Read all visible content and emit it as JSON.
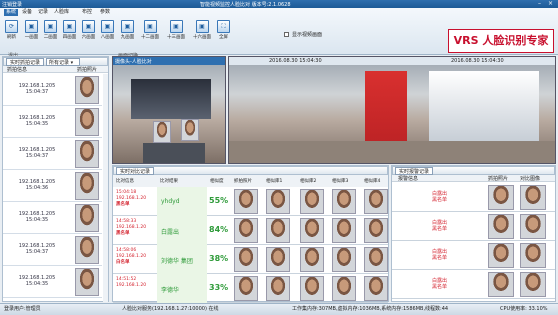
{
  "titlebar": {
    "app": "注销登录",
    "title": "智能视频监控人脸比对 版本号:2.1.0628"
  },
  "menu": [
    "系统",
    "设备",
    "记录",
    "人脸库",
    "布控",
    "参数"
  ],
  "toolbar": {
    "buttons": [
      "刷新",
      "一画面",
      "二画面",
      "四画面",
      "六画面",
      "八画面",
      "九画面",
      "十二画面",
      "十三画面",
      "十六画面",
      "全屏"
    ],
    "groups": [
      "退出",
      "画面切换"
    ],
    "checkbox_label": "显示视频画面"
  },
  "brand": "VRS 人脸识别专家",
  "left_panel": {
    "title": "实时抓拍记录",
    "filter": "所有记录",
    "col_info": "抓拍信息",
    "col_face": "抓拍照片",
    "rows": [
      {
        "ip": "192.168.1.205",
        "time": "15:04:37"
      },
      {
        "ip": "192.168.1.205",
        "time": "15:04:35"
      },
      {
        "ip": "192.168.1.205",
        "time": "15:04:37"
      },
      {
        "ip": "192.168.1.205",
        "time": "15:04:36"
      },
      {
        "ip": "192.168.1.205",
        "time": "15:04:35"
      },
      {
        "ip": "192.168.1.205",
        "time": "15:04:37"
      },
      {
        "ip": "192.168.1.205",
        "time": "15:04:35"
      }
    ]
  },
  "video": {
    "left_caption": "摄像头-人脸比对",
    "ts_left": "2016.08.30 15:04:30",
    "ts_right": "2016.08.30 15:04:30"
  },
  "compare": {
    "title": "实时对比记录",
    "cols": [
      "比对信息",
      "比对结果",
      "相似度",
      "抓拍照片",
      "相似库1",
      "相似库2",
      "相似库3",
      "相似库4"
    ],
    "rows": [
      {
        "time": "15:04:18",
        "ip": "192.168.1.20",
        "tag": "黑名单",
        "name": "yhdyd",
        "score": "55%"
      },
      {
        "time": "14:58:33",
        "ip": "192.168.1.20",
        "tag": "黑名单",
        "name": "白露出",
        "score": "84%"
      },
      {
        "time": "14:58:06",
        "ip": "192.168.1.20",
        "tag": "白名单",
        "name": "刘德华 集团",
        "score": "38%"
      },
      {
        "time": "14:51:52",
        "ip": "192.168.1.20",
        "tag": "",
        "name": "李德华",
        "score": "33%"
      }
    ]
  },
  "alarm": {
    "title": "实时报警记录",
    "cols": [
      "报警信息",
      "抓拍照片",
      "对比图像"
    ],
    "rows": [
      {
        "name": "白露出",
        "tag": "黑名单"
      },
      {
        "name": "白露出",
        "tag": "黑名单"
      },
      {
        "name": "白露出",
        "tag": "黑名单"
      },
      {
        "name": "白露出",
        "tag": "黑名单"
      }
    ]
  },
  "status": {
    "left": "登录用户:管理员",
    "mid": "人脸比对服务(192.168.1.27:10000) 在线",
    "right": "工作集内存:307MB,虚拟内存:1036MB,系统内存:1586MB,线程数:44",
    "cpu": "CPU使用率: 33.10%"
  },
  "colors": {
    "accent": "#2e6fb0",
    "brand": "#c8102e",
    "score": "#2f9b3a"
  }
}
